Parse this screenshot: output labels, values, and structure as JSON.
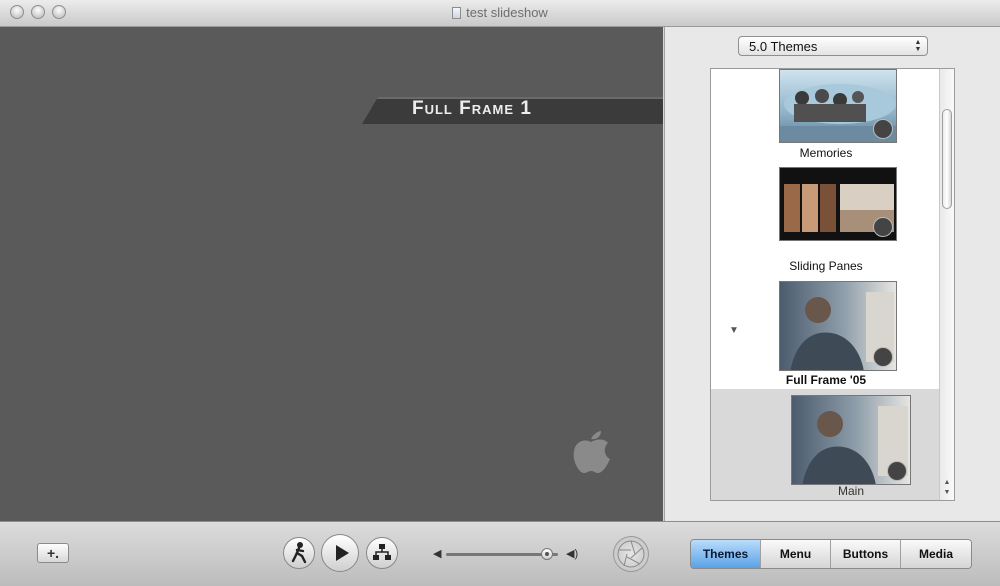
{
  "window": {
    "title": "test slideshow"
  },
  "preview": {
    "banner_text": "Full Frame 1"
  },
  "themes_panel": {
    "popup_value": "5.0 Themes",
    "items": [
      {
        "label": "Memories",
        "thumb_text": ""
      },
      {
        "label": "Sliding Panes",
        "thumb_text": ""
      },
      {
        "label": "Full Frame '05",
        "thumb_text": ""
      },
      {
        "label": "Main",
        "thumb_text": ""
      }
    ]
  },
  "toolbar": {
    "add_label": "+.",
    "tabs": [
      "Themes",
      "Menu",
      "Buttons",
      "Media"
    ],
    "active_tab": "Themes",
    "volume_level": 0.9
  },
  "colors": {
    "accent_tab": "#5aa2e6",
    "preview_bg": "#5a5a5a"
  }
}
